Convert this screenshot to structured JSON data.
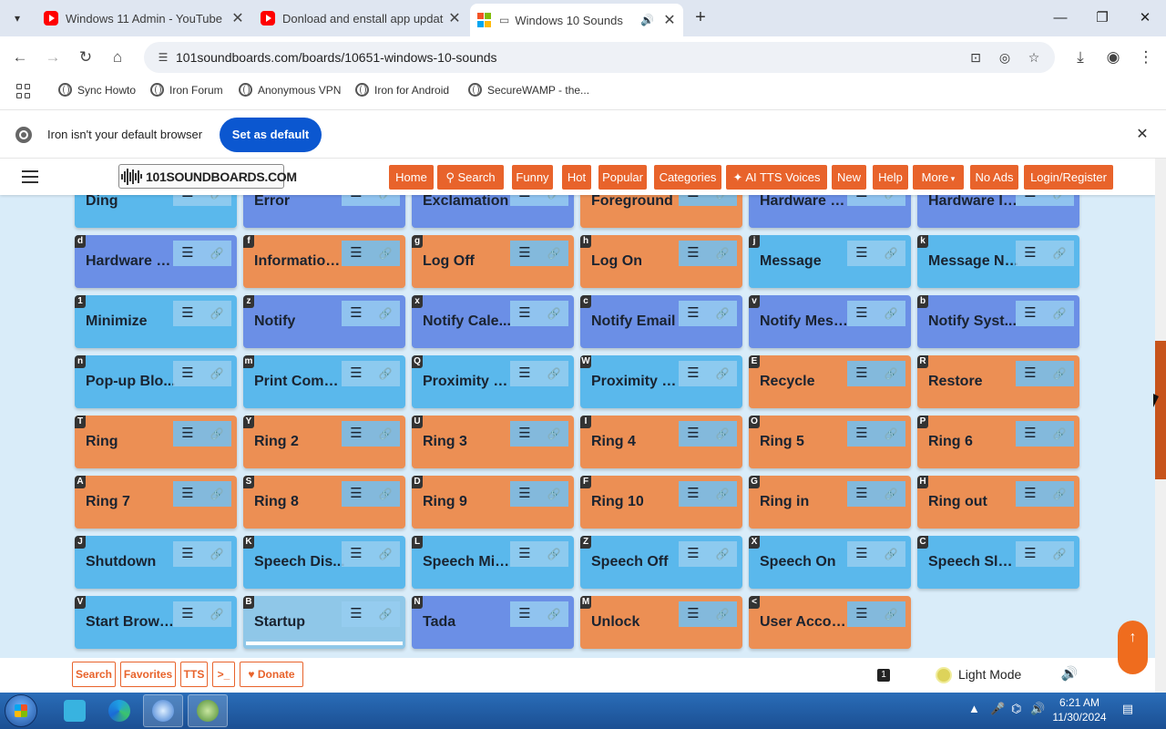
{
  "tabs": [
    {
      "title": "Windows 11 Admin - YouTube",
      "icon": "youtube-icon"
    },
    {
      "title": "Donload and enstall app updat",
      "icon": "youtube-icon"
    },
    {
      "title": "Windows 10 Sounds",
      "icon": "windows-icon",
      "active": true
    }
  ],
  "address": {
    "url": "101soundboards.com/boards/10651-windows-10-sounds"
  },
  "bookmarks": [
    "Sync Howto",
    "Iron Forum",
    "Anonymous VPN",
    "Iron for Android",
    "SecureWAMP - the..."
  ],
  "infobar": {
    "message": "Iron isn't your default browser",
    "button": "Set as default"
  },
  "site": {
    "logo": "101SOUNDBOARDS.COM",
    "nav": [
      "Home",
      "Search",
      "Funny",
      "Hot",
      "Popular",
      "Categories",
      "AI TTS Voices",
      "New",
      "Help",
      "More",
      "No Ads",
      "Login/Register"
    ]
  },
  "colors": {
    "sky": "#5ab8ec",
    "purple": "#6b8fe6",
    "orange": "#ec8f54",
    "accent": "#e8632b"
  },
  "sounds": [
    {
      "key": "",
      "name": "Ding",
      "color": "sky"
    },
    {
      "key": "",
      "name": "Error",
      "color": "purple"
    },
    {
      "key": "",
      "name": "Exclamation",
      "color": "purple"
    },
    {
      "key": "",
      "name": "Foreground",
      "color": "orange"
    },
    {
      "key": "",
      "name": "Hardware Fail",
      "color": "purple"
    },
    {
      "key": "",
      "name": "Hardware In...",
      "color": "purple"
    },
    {
      "key": "d",
      "name": "Hardware R...",
      "color": "purple"
    },
    {
      "key": "f",
      "name": "Information...",
      "color": "orange"
    },
    {
      "key": "g",
      "name": "Log Off",
      "color": "orange"
    },
    {
      "key": "h",
      "name": "Log On",
      "color": "orange"
    },
    {
      "key": "j",
      "name": "Message",
      "color": "sky"
    },
    {
      "key": "k",
      "name": "Message Nu...",
      "color": "sky"
    },
    {
      "key": "1",
      "name": "Minimize",
      "color": "sky"
    },
    {
      "key": "z",
      "name": "Notify",
      "color": "purple"
    },
    {
      "key": "x",
      "name": "Notify Cale...",
      "color": "purple"
    },
    {
      "key": "c",
      "name": "Notify Email",
      "color": "purple"
    },
    {
      "key": "v",
      "name": "Notify Mess...",
      "color": "purple"
    },
    {
      "key": "b",
      "name": "Notify Syst...",
      "color": "purple"
    },
    {
      "key": "n",
      "name": "Pop-up Blo...",
      "color": "sky"
    },
    {
      "key": "m",
      "name": "Print Compl...",
      "color": "sky"
    },
    {
      "key": "Q",
      "name": "Proximity C...",
      "color": "sky"
    },
    {
      "key": "W",
      "name": "Proximity N...",
      "color": "sky"
    },
    {
      "key": "E",
      "name": "Recycle",
      "color": "orange"
    },
    {
      "key": "R",
      "name": "Restore",
      "color": "orange"
    },
    {
      "key": "T",
      "name": "Ring",
      "color": "orange"
    },
    {
      "key": "Y",
      "name": "Ring 2",
      "color": "orange"
    },
    {
      "key": "U",
      "name": "Ring 3",
      "color": "orange"
    },
    {
      "key": "I",
      "name": "Ring 4",
      "color": "orange"
    },
    {
      "key": "O",
      "name": "Ring 5",
      "color": "orange"
    },
    {
      "key": "P",
      "name": "Ring 6",
      "color": "orange"
    },
    {
      "key": "A",
      "name": "Ring 7",
      "color": "orange"
    },
    {
      "key": "S",
      "name": "Ring 8",
      "color": "orange"
    },
    {
      "key": "D",
      "name": "Ring 9",
      "color": "orange"
    },
    {
      "key": "F",
      "name": "Ring 10",
      "color": "orange"
    },
    {
      "key": "G",
      "name": "Ring in",
      "color": "orange"
    },
    {
      "key": "H",
      "name": "Ring out",
      "color": "orange"
    },
    {
      "key": "J",
      "name": "Shutdown",
      "color": "sky"
    },
    {
      "key": "K",
      "name": "Speech Dis...",
      "color": "sky"
    },
    {
      "key": "L",
      "name": "Speech Mis...",
      "color": "sky"
    },
    {
      "key": "Z",
      "name": "Speech Off",
      "color": "sky"
    },
    {
      "key": "X",
      "name": "Speech On",
      "color": "sky"
    },
    {
      "key": "C",
      "name": "Speech Sleep",
      "color": "sky"
    },
    {
      "key": "V",
      "name": "Start Brows...",
      "color": "sky"
    },
    {
      "key": "B",
      "name": "Startup",
      "color": "sky",
      "playing": true
    },
    {
      "key": "N",
      "name": "Tada",
      "color": "purple"
    },
    {
      "key": "M",
      "name": "Unlock",
      "color": "orange"
    },
    {
      "key": "<",
      "name": "User Accou...",
      "color": "orange"
    }
  ],
  "bottom_bar": {
    "buttons": [
      "Search",
      "Favorites",
      "TTS",
      ">_",
      "Donate"
    ],
    "page_badge": "1",
    "mode_label": "Light Mode"
  },
  "taskbar": {
    "time": "6:21 AM",
    "date": "11/30/2024"
  }
}
